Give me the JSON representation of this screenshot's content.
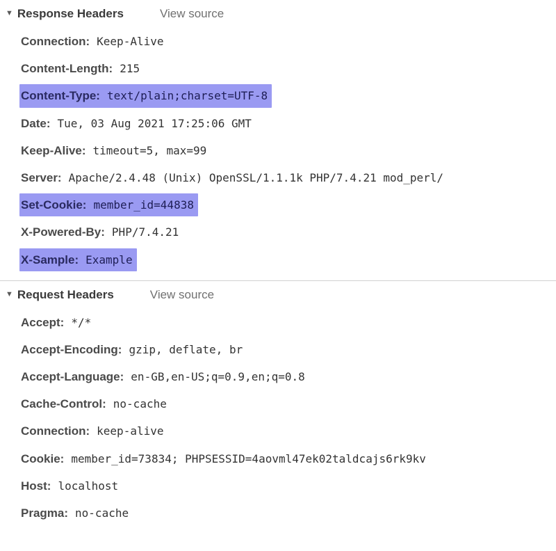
{
  "response": {
    "title": "Response Headers",
    "viewSource": "View source",
    "headers": [
      {
        "name": "Connection:",
        "value": "Keep-Alive",
        "highlighted": false
      },
      {
        "name": "Content-Length:",
        "value": "215",
        "highlighted": false
      },
      {
        "name": "Content-Type:",
        "value": "text/plain;charset=UTF-8",
        "highlighted": true
      },
      {
        "name": "Date:",
        "value": "Tue, 03 Aug 2021 17:25:06 GMT",
        "highlighted": false
      },
      {
        "name": "Keep-Alive:",
        "value": "timeout=5, max=99",
        "highlighted": false
      },
      {
        "name": "Server:",
        "value": "Apache/2.4.48 (Unix) OpenSSL/1.1.1k PHP/7.4.21 mod_perl/",
        "highlighted": false
      },
      {
        "name": "Set-Cookie:",
        "value": "member_id=44838",
        "highlighted": true
      },
      {
        "name": "X-Powered-By:",
        "value": "PHP/7.4.21",
        "highlighted": false
      },
      {
        "name": "X-Sample:",
        "value": "Example",
        "highlighted": true
      }
    ]
  },
  "request": {
    "title": "Request Headers",
    "viewSource": "View source",
    "headers": [
      {
        "name": "Accept:",
        "value": "*/*",
        "highlighted": false
      },
      {
        "name": "Accept-Encoding:",
        "value": "gzip, deflate, br",
        "highlighted": false
      },
      {
        "name": "Accept-Language:",
        "value": "en-GB,en-US;q=0.9,en;q=0.8",
        "highlighted": false
      },
      {
        "name": "Cache-Control:",
        "value": "no-cache",
        "highlighted": false
      },
      {
        "name": "Connection:",
        "value": "keep-alive",
        "highlighted": false
      },
      {
        "name": "Cookie:",
        "value": "member_id=73834; PHPSESSID=4aovml47ek02taldcajs6rk9kv",
        "highlighted": false
      },
      {
        "name": "Host:",
        "value": "localhost",
        "highlighted": false
      },
      {
        "name": "Pragma:",
        "value": "no-cache",
        "highlighted": false
      }
    ]
  }
}
